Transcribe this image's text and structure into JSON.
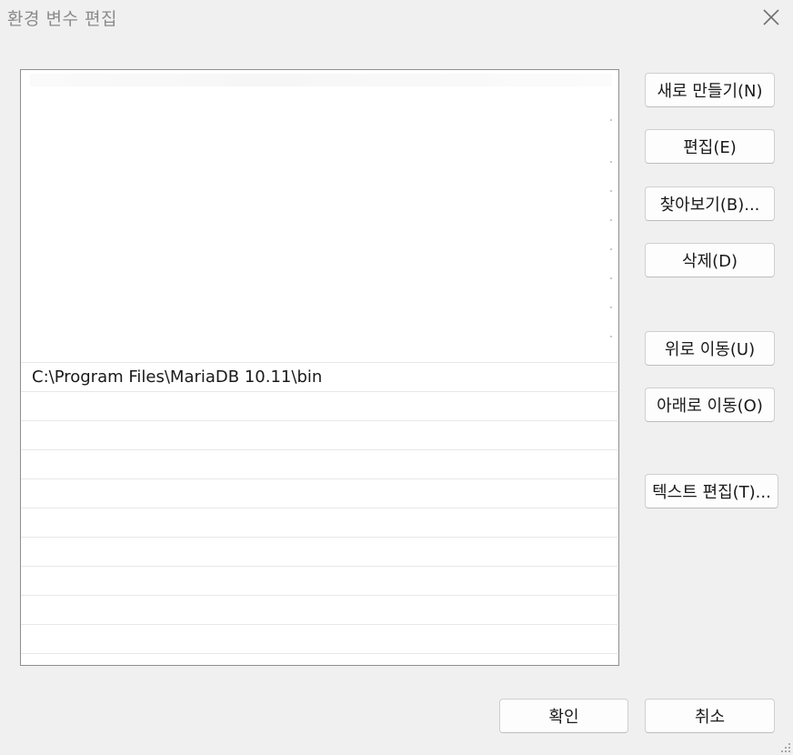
{
  "window": {
    "title": "환경 변수 편집"
  },
  "list": {
    "visible_entry": "C:\\Program Files\\MariaDB 10.11\\bin"
  },
  "buttons": {
    "new": "새로 만들기(N)",
    "edit": "편집(E)",
    "browse": "찾아보기(B)...",
    "delete": "삭제(D)",
    "move_up": "위로 이동(U)",
    "move_down": "아래로 이동(O)",
    "edit_text": "텍스트 편집(T)...",
    "ok": "확인",
    "cancel": "취소"
  },
  "colors": {
    "window_bg": "#f0f0f0",
    "list_bg": "#ffffff",
    "list_border": "#8f8f8f",
    "button_bg": "#fdfdfd",
    "title_text": "#8a8a8a"
  },
  "icons": {
    "close": "close-icon",
    "resize_grip": "resize-grip-icon"
  }
}
